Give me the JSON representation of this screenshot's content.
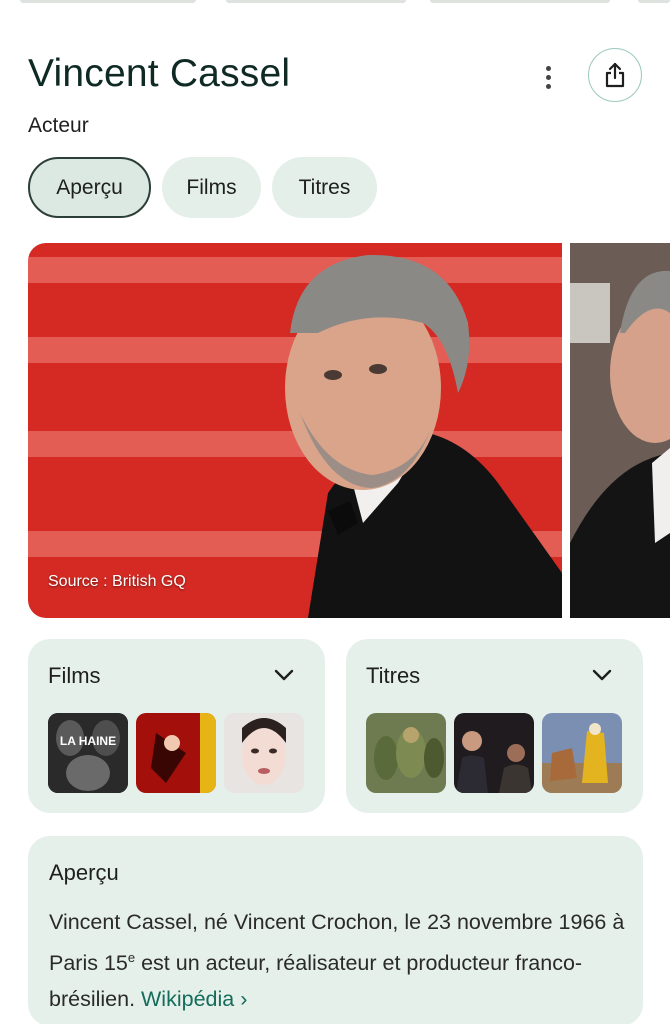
{
  "header": {
    "title": "Vincent Cassel",
    "subtitle": "Acteur"
  },
  "tabs": [
    {
      "label": "Aperçu",
      "active": true
    },
    {
      "label": "Films",
      "active": false
    },
    {
      "label": "Titres",
      "active": false
    }
  ],
  "hero_image": {
    "source_label": "Source : British GQ"
  },
  "films_card": {
    "title": "Films",
    "thumbnails": [
      "La Haine poster",
      "Irreversible poster",
      "Black Swan poster"
    ],
    "thumbnail_text": "LA HAINE"
  },
  "titres_card": {
    "title": "Titres",
    "thumbnails": [
      "Shrek still",
      "Film still",
      "Animated still"
    ]
  },
  "overview": {
    "title": "Aperçu",
    "text_before_sup": "Vincent Cassel, né Vincent Crochon, le 23 novembre 1966 à Paris 15",
    "sup": "e",
    "text_after_sup": " est un acteur, réalisateur et producteur franco-brésilien. ",
    "link_label": "Wikipédia",
    "link_arrow": "›"
  },
  "colors": {
    "accent": "#146c5a",
    "chip_bg": "#e4efe9",
    "card_bg": "#e6f0eb",
    "title_color": "#0f2a24"
  }
}
